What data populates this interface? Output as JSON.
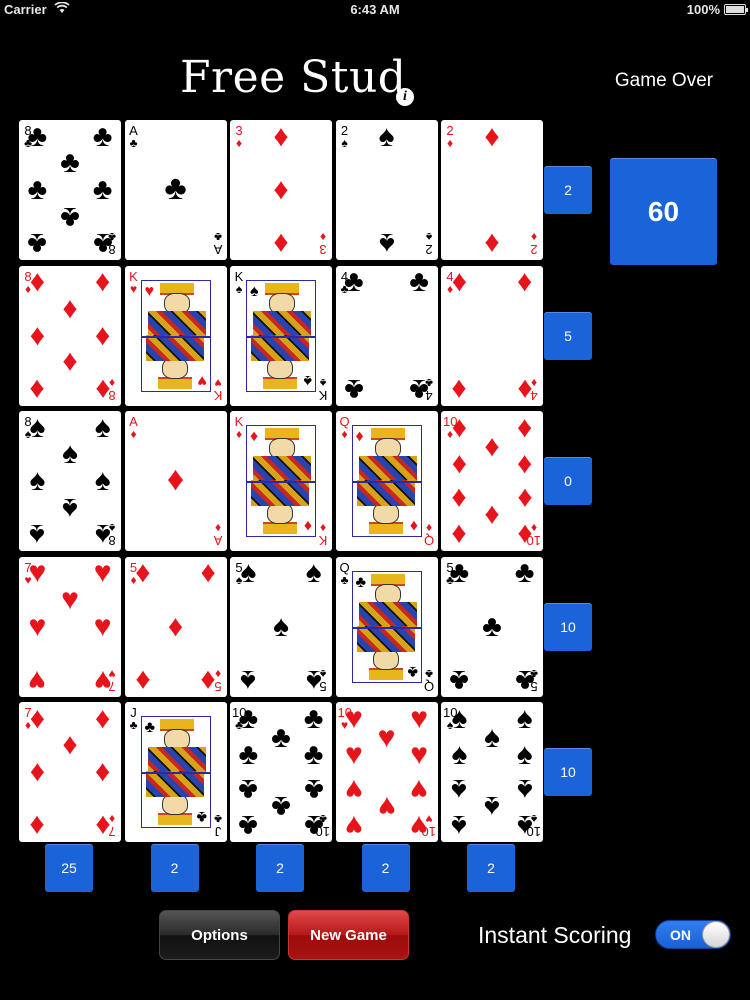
{
  "status_bar": {
    "carrier": "Carrier",
    "time": "6:43 AM",
    "battery": "100%"
  },
  "title": "Free Stud",
  "info_glyph": "i",
  "game_status": "Game Over",
  "total_score": "60",
  "colors": {
    "score_blue": "#1a63d8",
    "red_suit": "#e8141c",
    "new_game_red": "#b41818"
  },
  "board": [
    [
      {
        "rank": "8",
        "suit": "clubs"
      },
      {
        "rank": "A",
        "suit": "clubs"
      },
      {
        "rank": "3",
        "suit": "diamonds"
      },
      {
        "rank": "2",
        "suit": "spades"
      },
      {
        "rank": "2",
        "suit": "diamonds"
      }
    ],
    [
      {
        "rank": "8",
        "suit": "diamonds"
      },
      {
        "rank": "K",
        "suit": "hearts"
      },
      {
        "rank": "K",
        "suit": "spades"
      },
      {
        "rank": "4",
        "suit": "clubs"
      },
      {
        "rank": "4",
        "suit": "diamonds"
      }
    ],
    [
      {
        "rank": "8",
        "suit": "spades"
      },
      {
        "rank": "A",
        "suit": "diamonds"
      },
      {
        "rank": "K",
        "suit": "diamonds"
      },
      {
        "rank": "Q",
        "suit": "diamonds"
      },
      {
        "rank": "10",
        "suit": "diamonds"
      }
    ],
    [
      {
        "rank": "7",
        "suit": "hearts"
      },
      {
        "rank": "5",
        "suit": "diamonds"
      },
      {
        "rank": "5",
        "suit": "spades"
      },
      {
        "rank": "Q",
        "suit": "clubs"
      },
      {
        "rank": "5",
        "suit": "clubs"
      }
    ],
    [
      {
        "rank": "7",
        "suit": "diamonds"
      },
      {
        "rank": "J",
        "suit": "clubs"
      },
      {
        "rank": "10",
        "suit": "clubs"
      },
      {
        "rank": "10",
        "suit": "hearts"
      },
      {
        "rank": "10",
        "suit": "spades"
      }
    ]
  ],
  "row_scores": [
    "2",
    "5",
    "0",
    "10",
    "10"
  ],
  "column_scores": [
    "25",
    "2",
    "2",
    "2",
    "2"
  ],
  "buttons": {
    "options": "Options",
    "new_game": "New Game"
  },
  "instant_scoring": {
    "label": "Instant Scoring",
    "state": "ON"
  }
}
